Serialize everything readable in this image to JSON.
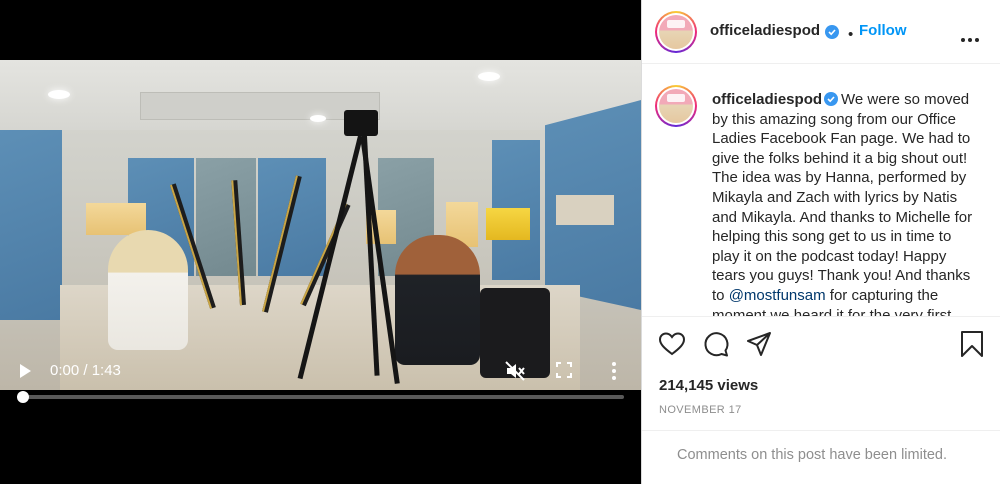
{
  "video": {
    "time_label": "0:00 / 1:43",
    "progress": 0.0,
    "icons": [
      "play-icon",
      "mute-icon",
      "fullscreen-icon",
      "more-vertical-icon"
    ]
  },
  "post": {
    "username": "officeladiespod",
    "follow_label": "Follow",
    "separator": "•",
    "caption_text": "We were so moved by this amazing song from our Office Ladies Facebook Fan page. We had to give the folks behind it a big shout out! The idea was by Hanna, performed by Mikayla and Zach with lyrics by Natis and Mikayla. And thanks to Michelle for helping this song get to us in time to play it on the podcast today! Happy tears you guys! Thank you! And thanks to",
    "mention": "@mostfunsam",
    "caption_tail": "for capturing the moment we heard it for the very first time.",
    "views": "214,145 views",
    "date": "NOVEMBER 17",
    "comments_limited": "Comments on this post have been limited."
  },
  "colors": {
    "accent": "#0095f6",
    "verified": "#3897f0",
    "muted_text": "#8e8e8e",
    "border": "#dbdbdb"
  },
  "icons": [
    "heart-icon",
    "comment-icon",
    "share-icon",
    "bookmark-icon",
    "more-horizontal-icon",
    "verified-icon"
  ]
}
